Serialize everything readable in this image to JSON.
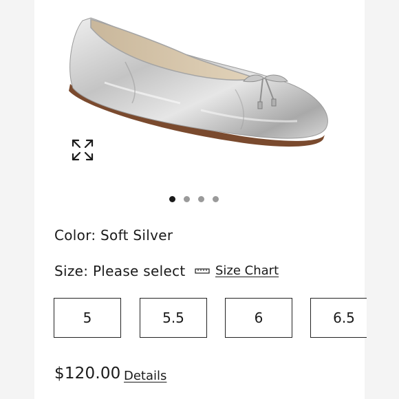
{
  "product": {
    "color_label": "Color: Soft Silver",
    "size_label": "Size: Please select",
    "size_chart_label": "Size Chart",
    "price": "$120.00",
    "details_label": "Details"
  },
  "carousel": {
    "slide_count": 4,
    "active_index": 0
  },
  "sizes": [
    "5",
    "5.5",
    "6",
    "6.5"
  ],
  "icons": {
    "expand": "expand-arrows-icon",
    "size_chart": "ruler-icon"
  },
  "colors": {
    "text": "#1a1a1a",
    "dot_inactive": "#9a9a9a",
    "shoe_silver": "#c9c9c9"
  }
}
